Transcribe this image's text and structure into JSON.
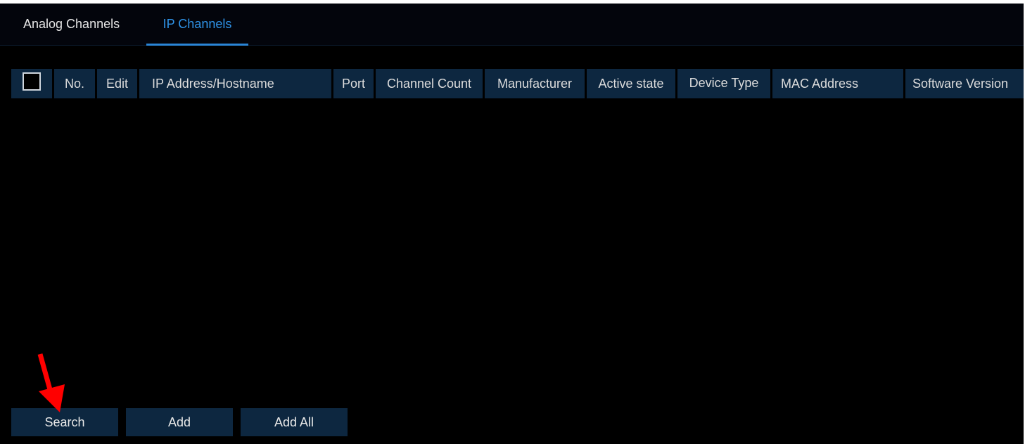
{
  "tabs": {
    "analog_label": "Analog Channels",
    "ip_label": "IP Channels",
    "active": "IP Channels"
  },
  "table": {
    "columns": [
      "No.",
      "Edit",
      "IP Address/Hostname",
      "Port",
      "Channel Count",
      "Manufacturer",
      "Active state",
      "Device Type",
      "MAC Address",
      "Software Version"
    ],
    "rows": []
  },
  "buttons": {
    "search": "Search",
    "add": "Add",
    "add_all": "Add All"
  },
  "annotation": {
    "arrow_color": "#ff0000",
    "arrow_icon": "red-arrow-icon"
  },
  "colors": {
    "background": "#000000",
    "header_bg": "#0d2740",
    "active_tab": "#2f93e8"
  }
}
